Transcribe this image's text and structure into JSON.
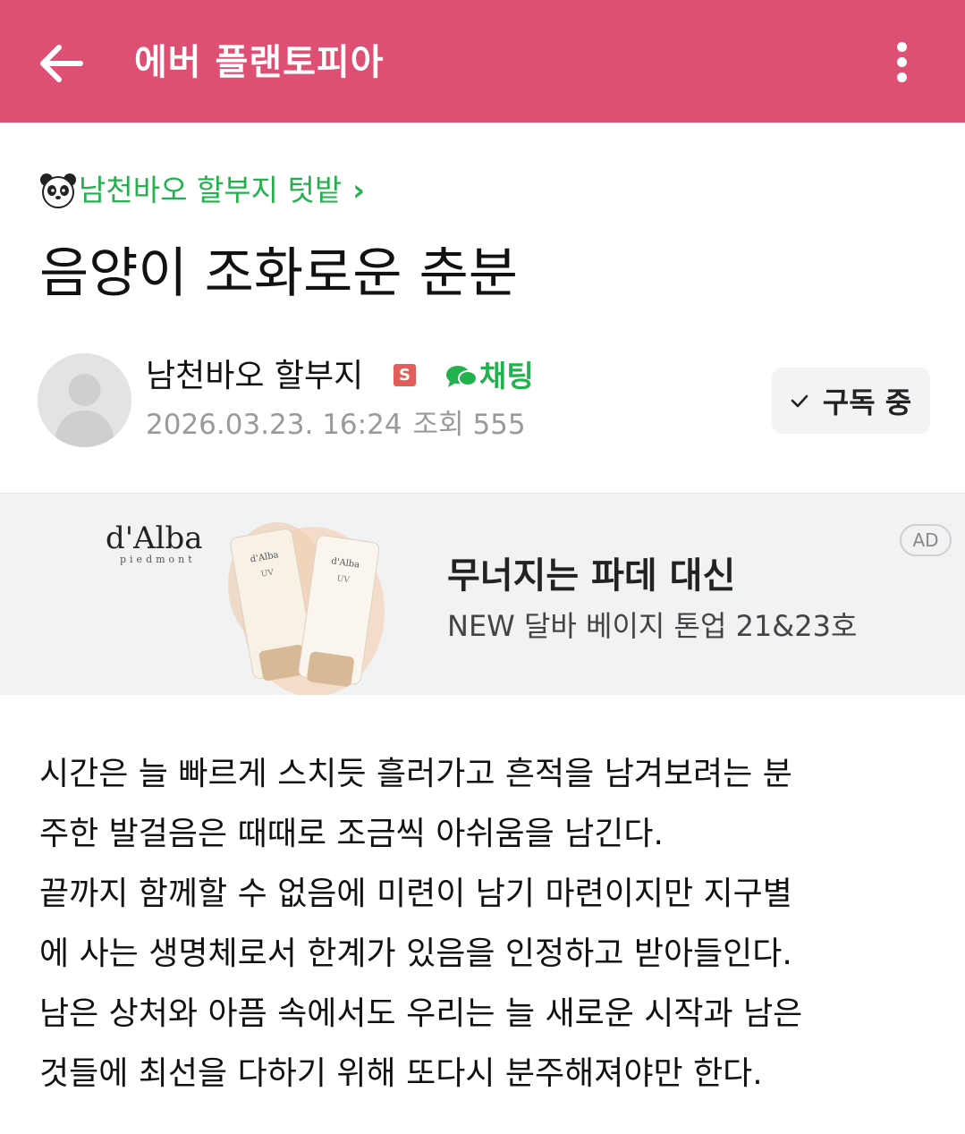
{
  "appbar": {
    "title": "에버 플랜토피아",
    "bg_color": "#de4f74",
    "back_icon": "back-arrow-icon",
    "more_icon": "more-vertical-icon"
  },
  "post": {
    "board_name": "남천바오 할부지 텃밭",
    "board_icon": "panda-icon",
    "board_chevron": "›",
    "title": "음양이 조화로운 춘분",
    "author": {
      "name": "남천바오 할부지",
      "badge": "S",
      "chat_label": "채팅",
      "date": "2026.03.23. 16:24",
      "views": "조회 555"
    },
    "subscribe_label": "구독 중",
    "body": [
      "시간은 늘 빠르게 스치듯 흘러가고 흔적을 남겨보려는 분",
      "주한 발걸음은 때때로 조금씩 아쉬움을 남긴다.",
      "끝까지 함께할 수 없음에 미련이 남기 마련이지만 지구별",
      "에 사는 생명체로서 한계가 있음을 인정하고 받아들인다.",
      "남은 상처와 아픔 속에서도 우리는 늘 새로운 시작과 남은",
      "것들에 최선을 다하기 위해 또다시 분주해져야만 한다."
    ]
  },
  "ad": {
    "brand": "d'Alba",
    "brand_sub": "piedmont",
    "headline": "무너지는 파데 대신",
    "subline": "NEW 달바 베이지 톤업 21&23호",
    "badge": "AD"
  },
  "colors": {
    "accent_green": "#22b14c",
    "meta_gray": "#9a9a9a"
  }
}
